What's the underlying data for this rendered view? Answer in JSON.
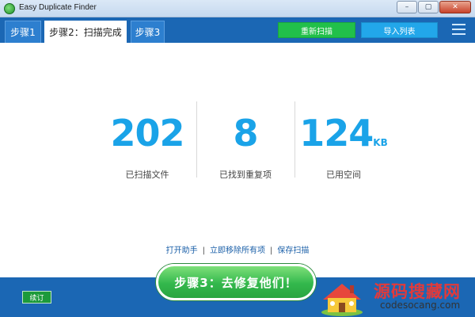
{
  "window": {
    "title": "Easy Duplicate Finder",
    "minimize_label": "–",
    "maximize_label": "▢",
    "close_label": "✕"
  },
  "tabs": [
    {
      "label": "步骤1",
      "active": false
    },
    {
      "label": "步骤2：扫描完成",
      "active": true
    },
    {
      "label": "步骤3",
      "active": false
    }
  ],
  "toolbar": {
    "rescan_label": "重新扫描",
    "import_label": "导入列表",
    "menu_icon": "hamburger-menu-icon"
  },
  "stats": [
    {
      "value": "202",
      "unit": "",
      "label": "已扫描文件"
    },
    {
      "value": "8",
      "unit": "",
      "label": "已找到重复项"
    },
    {
      "value": "124",
      "unit": "KB",
      "label": "已用空间"
    }
  ],
  "links": [
    "打开助手",
    "立即移除所有项",
    "保存扫描"
  ],
  "footer": {
    "pin_label": "续订",
    "step3_label": "步骤3：去修复他们！"
  },
  "watermark": {
    "title": "源码搜藏网",
    "domain": "codesocang.com"
  },
  "colors": {
    "header_blue": "#1b67b4",
    "rescan_green": "#21c04a",
    "import_blue": "#22a7ea",
    "stat_blue": "#1aa3e8"
  }
}
